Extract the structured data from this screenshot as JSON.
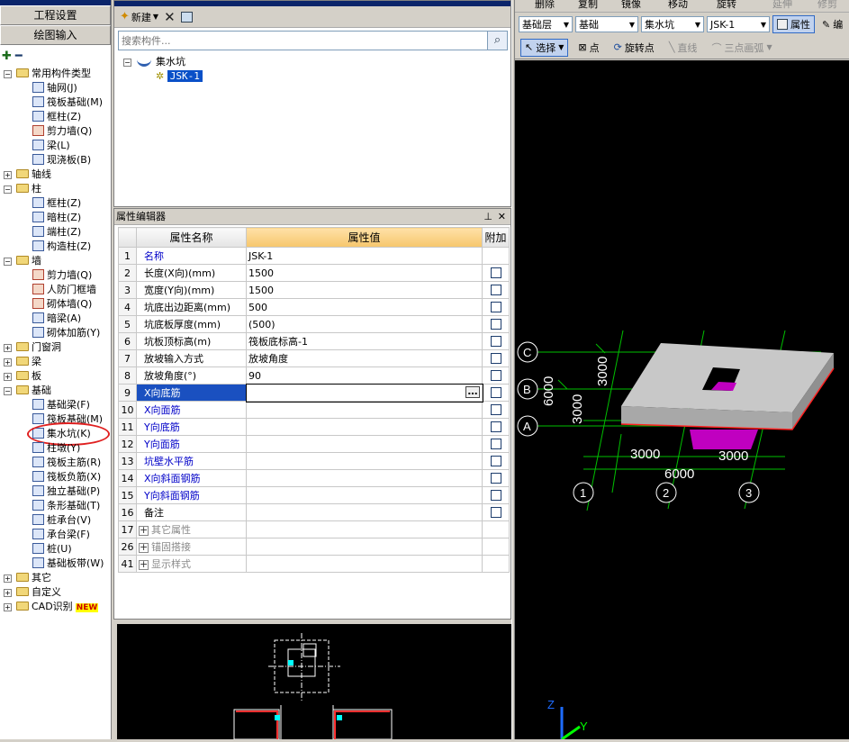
{
  "nav": {
    "buttons": [
      "工程设置",
      "绘图输入"
    ],
    "tree": [
      {
        "label": "常用构件类型",
        "level": 0,
        "type": "folder",
        "expanded": true
      },
      {
        "label": "轴网(J)",
        "level": 1,
        "type": "item"
      },
      {
        "label": "筏板基础(M)",
        "level": 1,
        "type": "item"
      },
      {
        "label": "框柱(Z)",
        "level": 1,
        "type": "item"
      },
      {
        "label": "剪力墙(Q)",
        "level": 1,
        "type": "item",
        "red": true
      },
      {
        "label": "梁(L)",
        "level": 1,
        "type": "item"
      },
      {
        "label": "现浇板(B)",
        "level": 1,
        "type": "item"
      },
      {
        "label": "轴线",
        "level": 0,
        "type": "folder",
        "expanded": false
      },
      {
        "label": "柱",
        "level": 0,
        "type": "folder",
        "expanded": true
      },
      {
        "label": "框柱(Z)",
        "level": 1,
        "type": "item"
      },
      {
        "label": "暗柱(Z)",
        "level": 1,
        "type": "item"
      },
      {
        "label": "端柱(Z)",
        "level": 1,
        "type": "item"
      },
      {
        "label": "构造柱(Z)",
        "level": 1,
        "type": "item"
      },
      {
        "label": "墙",
        "level": 0,
        "type": "folder",
        "expanded": true
      },
      {
        "label": "剪力墙(Q)",
        "level": 1,
        "type": "item",
        "red": true
      },
      {
        "label": "人防门框墙",
        "level": 1,
        "type": "item",
        "red": true
      },
      {
        "label": "砌体墙(Q)",
        "level": 1,
        "type": "item",
        "red": true
      },
      {
        "label": "暗梁(A)",
        "level": 1,
        "type": "item"
      },
      {
        "label": "砌体加筋(Y)",
        "level": 1,
        "type": "item"
      },
      {
        "label": "门窗洞",
        "level": 0,
        "type": "folder",
        "expanded": false
      },
      {
        "label": "梁",
        "level": 0,
        "type": "folder",
        "expanded": false
      },
      {
        "label": "板",
        "level": 0,
        "type": "folder",
        "expanded": false
      },
      {
        "label": "基础",
        "level": 0,
        "type": "folder",
        "expanded": true
      },
      {
        "label": "基础梁(F)",
        "level": 1,
        "type": "item"
      },
      {
        "label": "筏板基础(M)",
        "level": 1,
        "type": "item"
      },
      {
        "label": "集水坑(K)",
        "level": 1,
        "type": "item",
        "circled": true
      },
      {
        "label": "柱墩(Y)",
        "level": 1,
        "type": "item"
      },
      {
        "label": "筏板主筋(R)",
        "level": 1,
        "type": "item"
      },
      {
        "label": "筏板负筋(X)",
        "level": 1,
        "type": "item"
      },
      {
        "label": "独立基础(P)",
        "level": 1,
        "type": "item"
      },
      {
        "label": "条形基础(T)",
        "level": 1,
        "type": "item"
      },
      {
        "label": "桩承台(V)",
        "level": 1,
        "type": "item"
      },
      {
        "label": "承台梁(F)",
        "level": 1,
        "type": "item"
      },
      {
        "label": "桩(U)",
        "level": 1,
        "type": "item"
      },
      {
        "label": "基础板带(W)",
        "level": 1,
        "type": "item"
      },
      {
        "label": "其它",
        "level": 0,
        "type": "folder",
        "expanded": false
      },
      {
        "label": "自定义",
        "level": 0,
        "type": "folder",
        "expanded": false
      },
      {
        "label": "CAD识别",
        "level": 0,
        "type": "folder",
        "expanded": false,
        "badge": "NEW"
      }
    ]
  },
  "components": {
    "new_label": "新建",
    "search_placeholder": "搜索构件...",
    "tree_parent": "集水坑",
    "tree_child": "JSK-1"
  },
  "props": {
    "title": "属性编辑器",
    "headers": [
      "属性名称",
      "属性值",
      "附加"
    ],
    "rows": [
      {
        "n": "1",
        "name": "名称",
        "value": "JSK-1",
        "style": "blue",
        "check": false
      },
      {
        "n": "2",
        "name": "长度(X向)(mm)",
        "value": "1500",
        "style": "",
        "check": true
      },
      {
        "n": "3",
        "name": "宽度(Y向)(mm)",
        "value": "1500",
        "style": "",
        "check": true
      },
      {
        "n": "4",
        "name": "坑底出边距离(mm)",
        "value": "500",
        "style": "",
        "check": true
      },
      {
        "n": "5",
        "name": "坑底板厚度(mm)",
        "value": "(500)",
        "style": "",
        "check": true
      },
      {
        "n": "6",
        "name": "坑板顶标高(m)",
        "value": "筏板底标高-1",
        "style": "",
        "check": true
      },
      {
        "n": "7",
        "name": "放坡输入方式",
        "value": "放坡角度",
        "style": "",
        "check": true
      },
      {
        "n": "8",
        "name": "放坡角度(°)",
        "value": "90",
        "style": "",
        "check": true
      },
      {
        "n": "9",
        "name": "X向底筋",
        "value": "",
        "style": "sel",
        "check": true
      },
      {
        "n": "10",
        "name": "X向面筋",
        "value": "",
        "style": "blue",
        "check": true
      },
      {
        "n": "11",
        "name": "Y向底筋",
        "value": "",
        "style": "blue",
        "check": true
      },
      {
        "n": "12",
        "name": "Y向面筋",
        "value": "",
        "style": "blue",
        "check": true
      },
      {
        "n": "13",
        "name": "坑壁水平筋",
        "value": "",
        "style": "blue",
        "check": true
      },
      {
        "n": "14",
        "name": "X向斜面钢筋",
        "value": "",
        "style": "blue",
        "check": true
      },
      {
        "n": "15",
        "name": "Y向斜面钢筋",
        "value": "",
        "style": "blue",
        "check": true
      },
      {
        "n": "16",
        "name": "备注",
        "value": "",
        "style": "",
        "check": true
      },
      {
        "n": "17",
        "name": "其它属性",
        "value": "",
        "style": "group",
        "check": false
      },
      {
        "n": "26",
        "name": "锚固搭接",
        "value": "",
        "style": "group",
        "check": false
      },
      {
        "n": "41",
        "name": "显示样式",
        "value": "",
        "style": "group",
        "check": false
      }
    ]
  },
  "toolbar": {
    "top_items": [
      "删除",
      "复制",
      "镜像",
      "移动",
      "旋转",
      "延伸",
      "修剪"
    ],
    "layer": "基础层",
    "category": "基础",
    "type": "集水坑",
    "name": "JSK-1",
    "property_btn": "属性",
    "edit_btn": "编",
    "select_btn": "选择",
    "point_btn": "点",
    "rotate_point_btn": "旋转点",
    "line_btn": "直线",
    "arc_btn": "三点画弧"
  },
  "viewport": {
    "axis_rows": [
      "C",
      "B",
      "A"
    ],
    "axis_cols": [
      "1",
      "2",
      "3"
    ],
    "dim_3000": "3000",
    "dim_6000": "6000",
    "ucs": {
      "z": "Z",
      "y": "Y"
    }
  },
  "colors": {
    "grid": "#00c000",
    "slab": "#c0c0c0",
    "pit": "#c000c0",
    "edge": "#ff2020"
  }
}
